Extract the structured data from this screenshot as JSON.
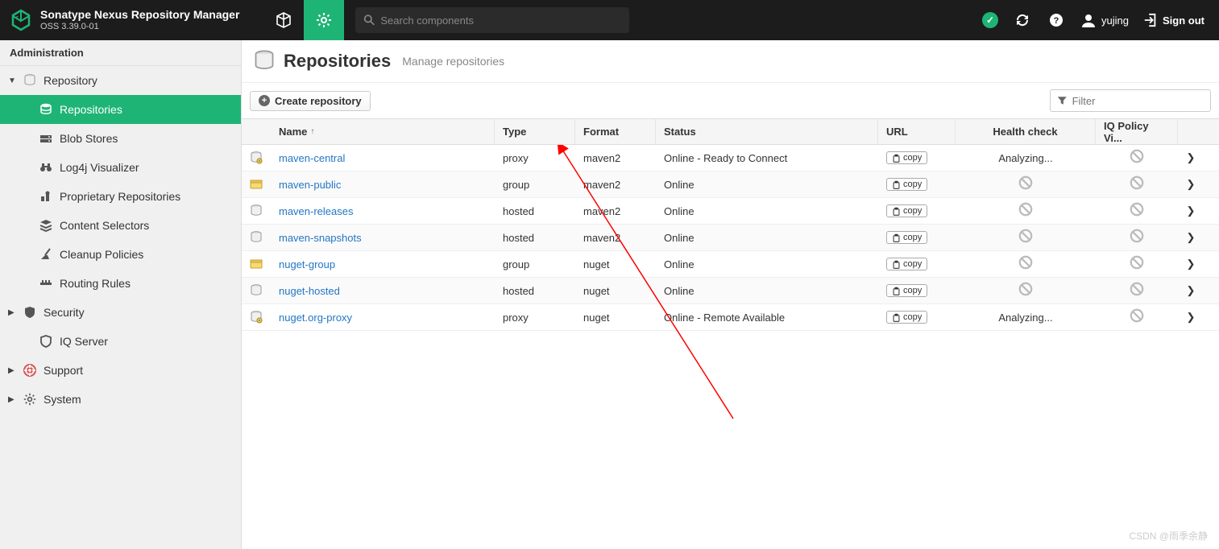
{
  "header": {
    "title": "Sonatype Nexus Repository Manager",
    "version": "OSS 3.39.0-01",
    "search_placeholder": "Search components",
    "username": "yujing",
    "signout": "Sign out"
  },
  "sidebar": {
    "section_title": "Administration",
    "items": [
      {
        "label": "Repository",
        "icon": "database",
        "expanded": true,
        "children": [
          {
            "label": "Repositories",
            "icon": "database",
            "active": true
          },
          {
            "label": "Blob Stores",
            "icon": "hdd"
          },
          {
            "label": "Log4j Visualizer",
            "icon": "binoculars"
          },
          {
            "label": "Proprietary Repositories",
            "icon": "prop"
          },
          {
            "label": "Content Selectors",
            "icon": "layers"
          },
          {
            "label": "Cleanup Policies",
            "icon": "broom"
          },
          {
            "label": "Routing Rules",
            "icon": "route"
          }
        ]
      },
      {
        "label": "Security",
        "icon": "shield",
        "expanded": false
      },
      {
        "label": "IQ Server",
        "icon": "iqshield",
        "indent": true
      },
      {
        "label": "Support",
        "icon": "lifebuoy",
        "expanded": false
      },
      {
        "label": "System",
        "icon": "gear",
        "expanded": false
      }
    ]
  },
  "page": {
    "title": "Repositories",
    "subtitle": "Manage repositories",
    "create_label": "Create repository",
    "filter_placeholder": "Filter"
  },
  "table": {
    "columns": [
      "Name",
      "Type",
      "Format",
      "Status",
      "URL",
      "Health check",
      "IQ Policy Vi..."
    ],
    "copy_label": "copy",
    "analyzing_label": "Analyzing...",
    "rows": [
      {
        "icon": "proxy",
        "name": "maven-central",
        "type": "proxy",
        "format": "maven2",
        "status": "Online - Ready to Connect",
        "health": "analyzing",
        "iq": "ban"
      },
      {
        "icon": "group",
        "name": "maven-public",
        "type": "group",
        "format": "maven2",
        "status": "Online",
        "health": "ban",
        "iq": "ban"
      },
      {
        "icon": "hosted",
        "name": "maven-releases",
        "type": "hosted",
        "format": "maven2",
        "status": "Online",
        "health": "ban",
        "iq": "ban"
      },
      {
        "icon": "hosted",
        "name": "maven-snapshots",
        "type": "hosted",
        "format": "maven2",
        "status": "Online",
        "health": "ban",
        "iq": "ban"
      },
      {
        "icon": "group",
        "name": "nuget-group",
        "type": "group",
        "format": "nuget",
        "status": "Online",
        "health": "ban",
        "iq": "ban"
      },
      {
        "icon": "hosted",
        "name": "nuget-hosted",
        "type": "hosted",
        "format": "nuget",
        "status": "Online",
        "health": "ban",
        "iq": "ban"
      },
      {
        "icon": "proxy",
        "name": "nuget.org-proxy",
        "type": "proxy",
        "format": "nuget",
        "status": "Online - Remote Available",
        "health": "analyzing",
        "iq": "ban"
      }
    ]
  },
  "watermark": "CSDN @雨季余静"
}
